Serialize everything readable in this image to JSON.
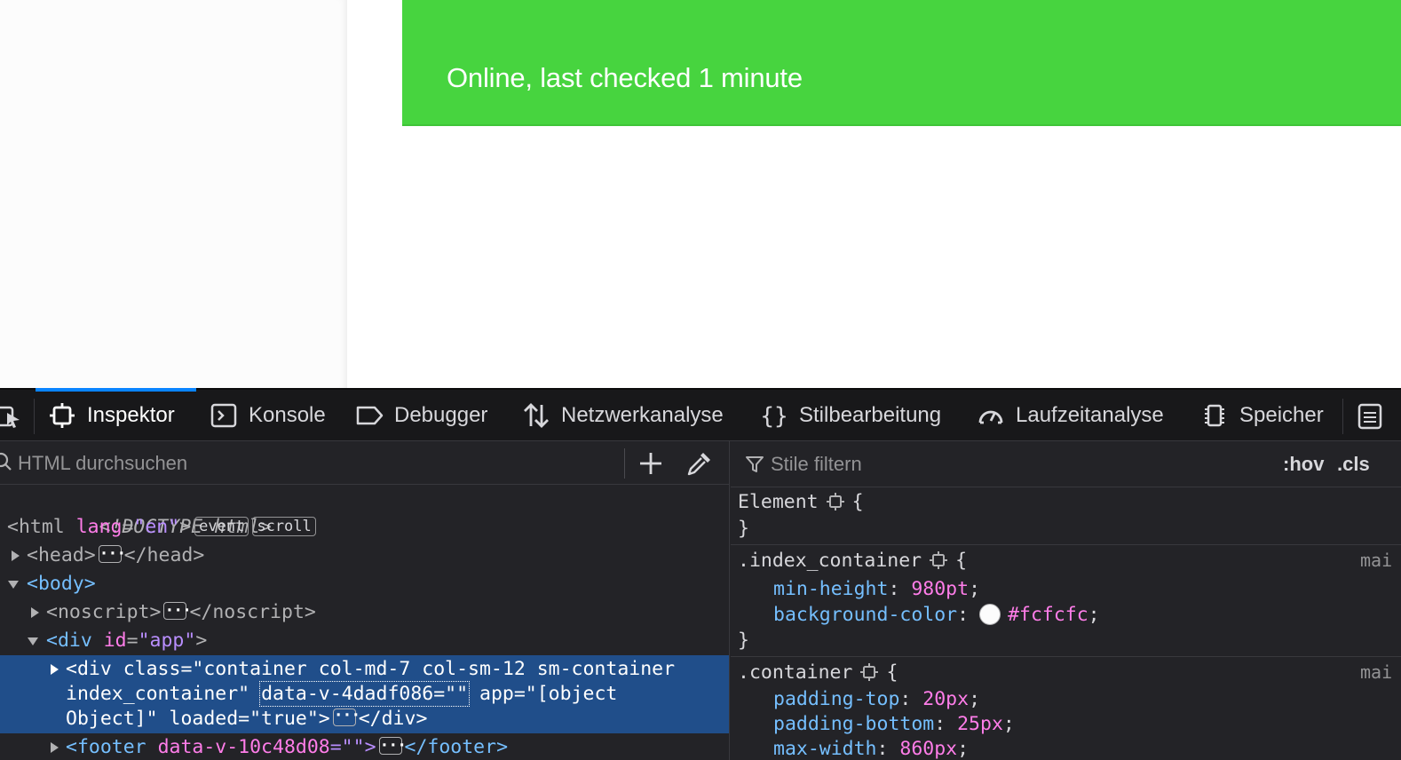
{
  "page": {
    "status_text": "Online, last checked 1 minute",
    "colors": {
      "banner": "#47d43f",
      "background": "#fcfcfc"
    }
  },
  "devtools": {
    "tabs": [
      {
        "label": "Inspektor",
        "icon": "inspector-icon"
      },
      {
        "label": "Konsole",
        "icon": "console-icon"
      },
      {
        "label": "Debugger",
        "icon": "debugger-icon"
      },
      {
        "label": "Netzwerkanalyse",
        "icon": "network-icon"
      },
      {
        "label": "Stilbearbeitung",
        "icon": "style-editor-icon"
      },
      {
        "label": "Laufzeitanalyse",
        "icon": "performance-icon"
      },
      {
        "label": "Speicher",
        "icon": "memory-icon"
      }
    ],
    "selected_tab": "Inspektor",
    "markup": {
      "search_placeholder": "HTML durchsuchen",
      "doctype": "<!DOCTYPE html>",
      "html_open": "<html",
      "html_attr": "lang",
      "html_val": "\"en\"",
      "html_close": ">",
      "badge_event": "event",
      "badge_scroll": "scroll",
      "head_open": "<head>",
      "head_close": "</head>",
      "body_open": "<body>",
      "noscript_open": "<noscript>",
      "noscript_close": "</noscript>",
      "div_app_open": "<div",
      "div_app_attr": "id",
      "div_app_val": "\"app\"",
      "selected_line1": "<div class=\"container col-md-7 col-sm-12 sm-container",
      "selected_line2_a": "index_container\" ",
      "selected_line2_focus": "data-v-4dadf086=\"\"",
      "selected_line2_b": " app=\"[object",
      "selected_line3_a": "Object]\" loaded=\"true\">",
      "selected_line3_b": "</div>",
      "footer_open": "<footer",
      "footer_attr": "data-v-10c48d08",
      "footer_val": "=\"\">",
      "footer_close": "</footer>"
    },
    "rules": {
      "filter_placeholder": "Stile filtern",
      "hov": ":hov",
      "cls": ".cls",
      "blocks": [
        {
          "selector": "Element",
          "source": "",
          "props": []
        },
        {
          "selector": ".index_container",
          "source": "mai",
          "props": [
            {
              "name": "min-height",
              "value": "980pt"
            },
            {
              "name": "background-color",
              "value": "#fcfcfc"
            }
          ]
        },
        {
          "selector": ".container",
          "source": "mai",
          "props": [
            {
              "name": "padding-top",
              "value": "20px"
            },
            {
              "name": "padding-bottom",
              "value": "25px"
            },
            {
              "name": "max-width",
              "value": "860px"
            }
          ]
        }
      ]
    }
  }
}
